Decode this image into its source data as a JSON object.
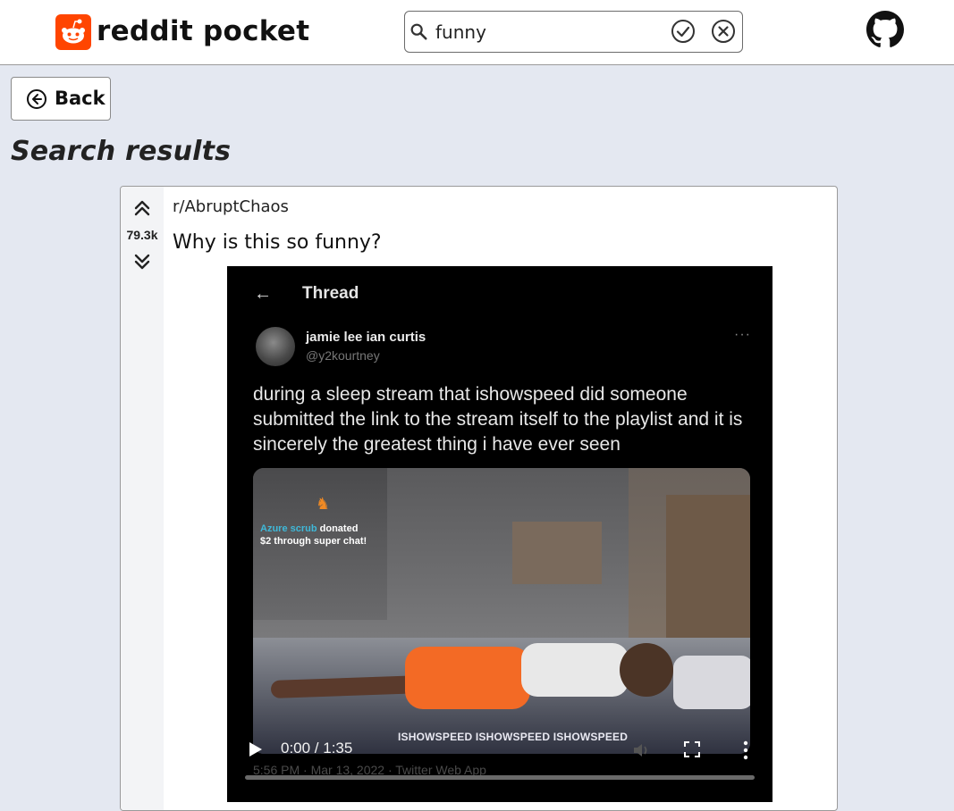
{
  "header": {
    "brand": "reddit pocket",
    "search": {
      "value": "funny",
      "placeholder": ""
    },
    "colors": {
      "brand": "#ff4500"
    }
  },
  "nav": {
    "back_label": "Back"
  },
  "page": {
    "title": "Search results"
  },
  "post": {
    "subreddit": "r/AbruptChaos",
    "score": "79.3k",
    "title": "Why is this so funny?",
    "video": {
      "thread_heading": "Thread",
      "author_name": "jamie lee ian curtis",
      "author_handle": "@y2kourtney",
      "more_glyph": "···",
      "tweet_text": "during a sleep stream that ishowspeed did someone submitted the link to the stream itself to the playlist and it is sincerely the greatest thing i have ever seen",
      "donation_name": "Azure scrub",
      "donation_line1_rest": " donated",
      "donation_line2": "$2 through super chat!",
      "watermark": "ISHOWSPEED  ISHOWSPEED  ISHOWSPEED",
      "tweet_footer": "5:56 PM · Mar 13, 2022 · Twitter Web App",
      "current_time": "0:00",
      "duration": "1:35",
      "time_display": "0:00 / 1:35",
      "progress": 0
    }
  },
  "icons": {
    "brand": "reddit-logo-icon",
    "search": "search-icon",
    "submit": "check-circle-icon",
    "clear": "x-circle-icon",
    "github": "github-icon",
    "back": "arrow-left-circle-icon",
    "upvote": "double-chevron-up-icon",
    "downvote": "double-chevron-down-icon",
    "play": "play-icon",
    "mute": "volume-icon",
    "fullscreen": "fullscreen-icon",
    "menu": "kebab-menu-icon"
  }
}
